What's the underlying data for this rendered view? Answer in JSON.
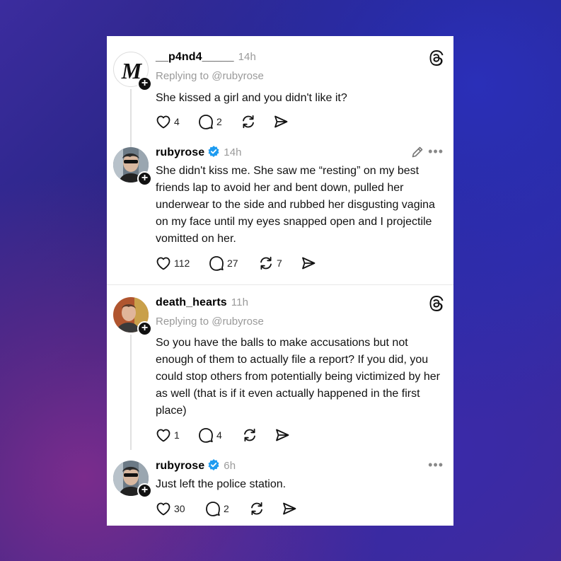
{
  "threads": [
    {
      "author": "__p4nd4_____",
      "time": "14h",
      "replying_to": "Replying to @rubyrose",
      "text": "She kissed a girl and you didn't like it?",
      "likes": "4",
      "replies": "2",
      "reposts": ""
    },
    {
      "author": "rubyrose",
      "time": "14h",
      "text": "She didn't kiss me. She saw me “resting” on my best friends lap to avoid her and bent down, pulled her underwear to the side and rubbed her disgusting vagina on my face until my eyes snapped open and I projectile vomitted on her.",
      "likes": "112",
      "replies": "27",
      "reposts": "7"
    },
    {
      "author": "death_hearts",
      "time": "11h",
      "replying_to": "Replying to @rubyrose",
      "text": "So you have the balls to make accusations but not enough of them to actually file a report? If you did, you could stop others from potentially being victimized by her as well (that is if it even actually happened in the first place)",
      "likes": "1",
      "replies": "4",
      "reposts": ""
    },
    {
      "author": "rubyrose",
      "time": "6h",
      "text": "Just left the police station.",
      "likes": "30",
      "replies": "2",
      "reposts": ""
    }
  ],
  "ui": {
    "more_glyph": "•••",
    "plus_glyph": "+",
    "avatar_monogram": "M"
  },
  "colors": {
    "verified": "#1d9bf0",
    "muted": "#9a9a9a"
  },
  "icons": [
    "threads-logo-icon",
    "heart-icon",
    "comment-icon",
    "repost-icon",
    "share-icon",
    "verified-icon",
    "pencil-icon",
    "more-icon"
  ]
}
